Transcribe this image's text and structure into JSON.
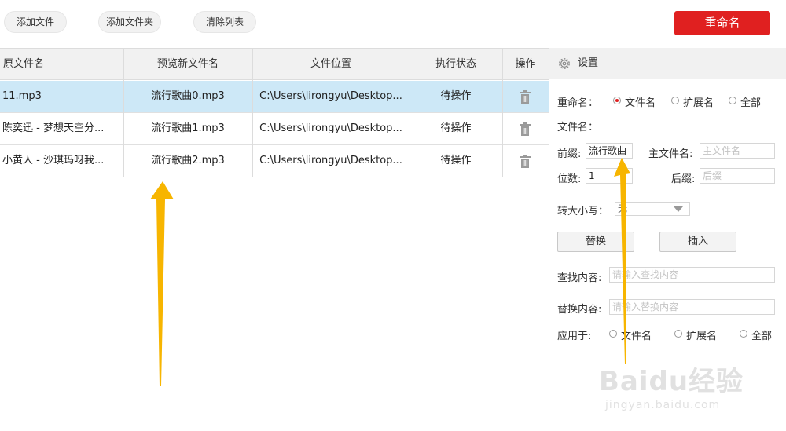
{
  "toolbar": {
    "add_file": "添加文件",
    "add_folder": "添加文件夹",
    "clear_list": "清除列表",
    "rename": "重命名"
  },
  "table": {
    "headers": [
      "原文件名",
      "预览新文件名",
      "文件位置",
      "执行状态",
      "操作"
    ],
    "rows": [
      {
        "original": "11.mp3",
        "preview": "流行歌曲0.mp3",
        "location": "C:\\Users\\lirongyu\\Desktop...",
        "status": "待操作"
      },
      {
        "original": "陈奕迅 - 梦想天空分...",
        "preview": "流行歌曲1.mp3",
        "location": "C:\\Users\\lirongyu\\Desktop...",
        "status": "待操作"
      },
      {
        "original": "小黄人 - 沙琪玛呀我...",
        "preview": "流行歌曲2.mp3",
        "location": "C:\\Users\\lirongyu\\Desktop...",
        "status": "待操作"
      }
    ],
    "selected_row": 0,
    "delete_icon": "trash-icon"
  },
  "settings": {
    "title": "设置",
    "title_icon": "gear-icon",
    "rename_label": "重命名：",
    "rename_options": [
      "文件名",
      "扩展名",
      "全部"
    ],
    "rename_selected": "文件名",
    "filename_label": "文件名：",
    "prefix_label": "前缀:",
    "prefix_value": "流行歌曲",
    "main_name_label": "主文件名:",
    "main_name_placeholder": "主文件名",
    "digits_label": "位数:",
    "digits_value": "1",
    "suffix_label": "后缀:",
    "suffix_placeholder": "后缀",
    "case_label": "转大小写：",
    "case_value": "无",
    "replace_button": "替换",
    "insert_button": "插入",
    "find_label": "查找内容:",
    "find_placeholder": "请输入查找内容",
    "replace_label": "替换内容:",
    "replace_placeholder": "请输入替换内容",
    "apply_label": "应用于:",
    "apply_options": [
      "文件名",
      "扩展名",
      "全部"
    ]
  },
  "colors": {
    "accent": "#e02020",
    "selected_row": "#cde8f7",
    "arrow": "#f7b500"
  },
  "watermark": {
    "brand": "Baidu经验",
    "url": "jingyan.baidu.com"
  }
}
